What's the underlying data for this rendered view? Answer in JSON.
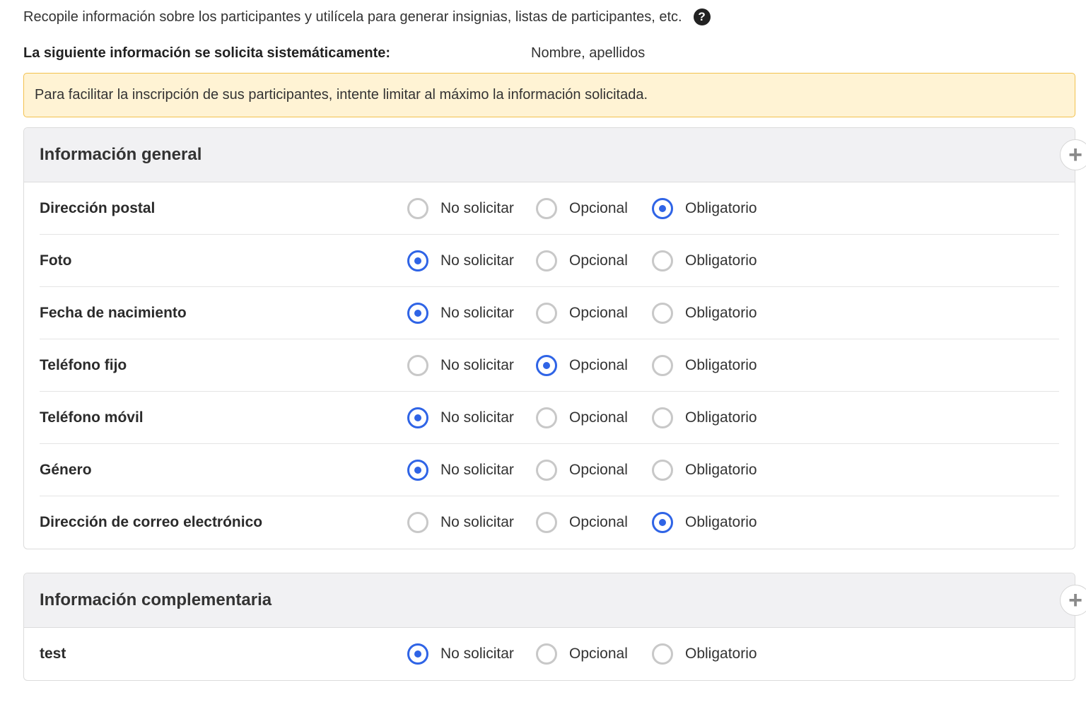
{
  "intro": {
    "text": "Recopile información sobre los participantes y utilícela para generar insignias, listas de participantes, etc.",
    "help_icon": "?"
  },
  "system_info": {
    "label": "La siguiente información se solicita sistemáticamente:",
    "value": "Nombre, apellidos"
  },
  "alert": {
    "text": "Para facilitar la inscripción de sus participantes, intente limitar al máximo la información solicitada."
  },
  "colors": {
    "accent": "#2f64e6",
    "alert_bg": "#fff3d4",
    "alert_border": "#f2c14e"
  },
  "options": [
    "No solicitar",
    "Opcional",
    "Obligatorio"
  ],
  "sections": [
    {
      "title": "Información general",
      "add_label": "+",
      "fields": [
        {
          "label": "Dirección postal",
          "selected": 2
        },
        {
          "label": "Foto",
          "selected": 0
        },
        {
          "label": "Fecha de nacimiento",
          "selected": 0
        },
        {
          "label": "Teléfono fijo",
          "selected": 1
        },
        {
          "label": "Teléfono móvil",
          "selected": 0
        },
        {
          "label": "Género",
          "selected": 0
        },
        {
          "label": "Dirección de correo electrónico",
          "selected": 2
        }
      ]
    },
    {
      "title": "Información complementaria",
      "add_label": "+",
      "fields": [
        {
          "label": "test",
          "selected": 0
        }
      ]
    }
  ]
}
